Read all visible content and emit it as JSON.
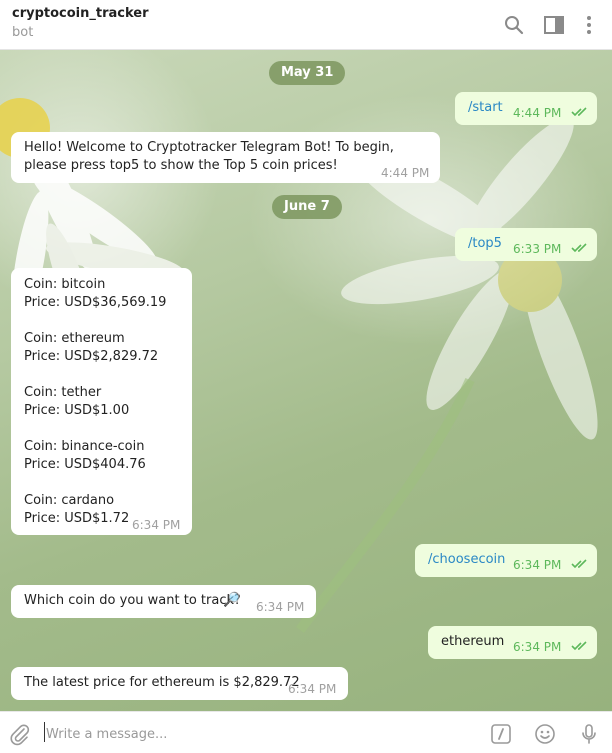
{
  "header": {
    "title": "cryptocoin_tracker",
    "status": "bot"
  },
  "icons": {
    "search": "search-icon",
    "sidebar": "sidebar-toggle-icon",
    "more": "more-vertical-icon",
    "attach": "paperclip-icon",
    "commands": "slash-command-icon",
    "emoji": "emoji-icon",
    "mic": "microphone-icon"
  },
  "dates": [
    "May 31",
    "June 7"
  ],
  "messages": [
    {
      "from": "me",
      "text": "/start",
      "time": "4:44 PM"
    },
    {
      "from": "bot",
      "text": "Hello! Welcome to Cryptotracker Telegram Bot! To begin, please press top5 to show the Top 5 coin prices!",
      "time": "4:44 PM"
    },
    {
      "from": "me",
      "text": "/top5",
      "time": "6:33 PM"
    },
    {
      "from": "bot",
      "coins": [
        {
          "coin": "Coin: bitcoin",
          "price": "Price: USD$36,569.19"
        },
        {
          "coin": "Coin: ethereum",
          "price": "Price: USD$2,829.72"
        },
        {
          "coin": "Coin: tether",
          "price": "Price: USD$1.00"
        },
        {
          "coin": "Coin: binance-coin",
          "price": "Price: USD$404.76"
        },
        {
          "coin": "Coin: cardano",
          "price": "Price: USD$1.72"
        }
      ],
      "time": "6:34 PM"
    },
    {
      "from": "me",
      "text": "/choosecoin",
      "time": "6:34 PM"
    },
    {
      "from": "bot",
      "text": "Which coin do you want to track?",
      "emoji": "🔎",
      "time": "6:34 PM"
    },
    {
      "from": "me",
      "text": "ethereum",
      "time": "6:34 PM"
    },
    {
      "from": "bot",
      "text": "The latest price for ethereum is $2,829.72",
      "time": "6:34 PM"
    }
  ],
  "input": {
    "placeholder": "Write a message..."
  },
  "colors": {
    "outgoing_bubble": "#effdde",
    "incoming_bubble": "#ffffff",
    "command_link": "#2a88c5",
    "check_marks": "#5db85b",
    "date_chip": "#7d965f"
  }
}
